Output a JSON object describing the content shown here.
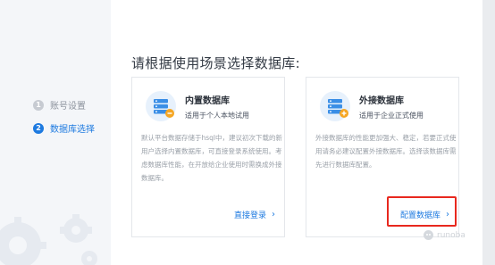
{
  "title": "请根据使用场景选择数据库:",
  "steps": [
    {
      "num": "1",
      "label": "账号设置"
    },
    {
      "num": "2",
      "label": "数据库选择"
    }
  ],
  "cards": [
    {
      "name": "内置数据库",
      "subtitle": "适用于个人本地试用",
      "description": "默认平台数据存储于hsql中，建议初次下载的新用户选择内置数据库，可直接登录系统使用。考虑数据库性能，在开放给企业使用时需换成外接数据库。",
      "link": "直接登录",
      "icon": "database-icon"
    },
    {
      "name": "外接数据库",
      "subtitle": "适用于企业正式使用",
      "description": "外接数据库的性能更加强大、稳定，若要正式使用请务必建议配置外接数据库。选择该数据库需先进行数据库配置。",
      "link": "配置数据库",
      "icon": "database-icon"
    }
  ],
  "watermark": "runoba",
  "colors": {
    "accent": "#1d7ae0",
    "highlight": "#e8281e"
  }
}
